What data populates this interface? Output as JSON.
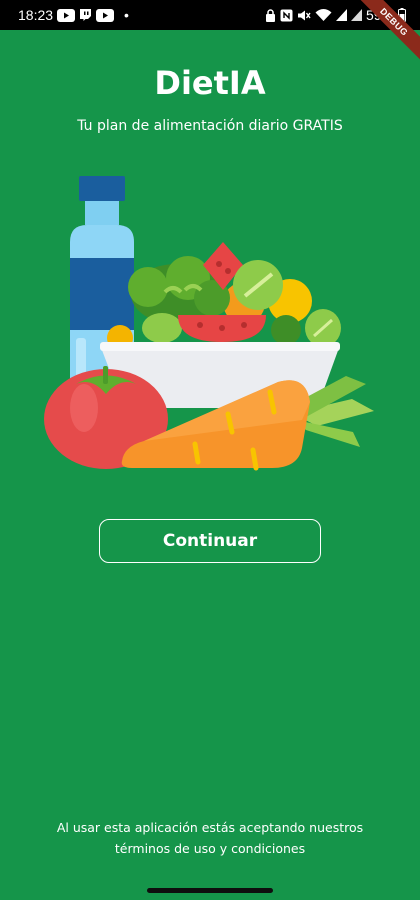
{
  "status_bar": {
    "time": "18:23",
    "dot": "•",
    "battery": "59%",
    "left_icons": [
      "youtube-icon",
      "twitch-icon",
      "youtube-icon"
    ],
    "right_icons": [
      "lock-icon",
      "nfc-icon",
      "mute-icon",
      "wifi-icon",
      "signal-icon",
      "signal-icon",
      "battery-icon"
    ]
  },
  "debug_banner": "DEBUG",
  "header": {
    "title": "DietIA",
    "subtitle": "Tu plan de alimentación diario GRATIS"
  },
  "continue_button": {
    "label": "Continuar"
  },
  "terms": {
    "line1": "Al usar esta aplicación estás aceptando nuestros",
    "line2": "términos de uso y condiciones"
  },
  "colors": {
    "background": "#15954a",
    "text": "#ffffff",
    "status_bar": "#000000",
    "debug_ribbon": "#8b2a1b"
  },
  "illustration": {
    "items": [
      "water-bottle",
      "salad-bowl",
      "tomato",
      "carrot"
    ]
  }
}
